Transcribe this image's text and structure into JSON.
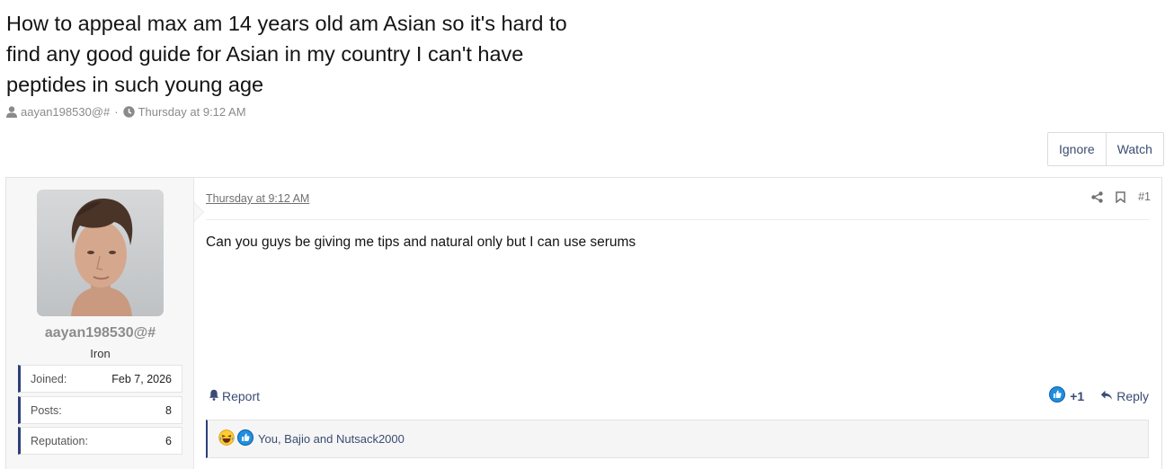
{
  "thread": {
    "title": "How to appeal max am 14 years old am Asian so it's hard to find any good guide for Asian in my country I can't have peptides in such young age",
    "author": "aayan198530@#",
    "separator": "·",
    "date": "Thursday at 9:12 AM"
  },
  "buttons": {
    "ignore": "Ignore",
    "watch": "Watch"
  },
  "user": {
    "name": "aayan198530@#",
    "title": "Iron",
    "stats": [
      {
        "label": "Joined:",
        "value": "Feb 7, 2026"
      },
      {
        "label": "Posts:",
        "value": "8"
      },
      {
        "label": "Reputation:",
        "value": "6"
      }
    ]
  },
  "post": {
    "date": "Thursday at 9:12 AM",
    "number": "#1",
    "body": "Can you guys be giving me tips and natural only but I can use serums",
    "report_label": "Report",
    "reaction_score": "+1",
    "reply_label": "Reply",
    "reactions_text": "You, Bajio and Nutsack2000"
  },
  "colors": {
    "link": "#3a4c72",
    "accent_border": "#2d3f78",
    "like_blue": "#1f8fe0"
  },
  "icons": {
    "user": "user-icon",
    "clock": "clock-icon",
    "share": "share-icon",
    "bookmark": "bookmark-icon",
    "bell": "bell-icon",
    "like": "like-icon",
    "reply": "reply-icon",
    "laugh": "laugh-emoji-icon"
  }
}
